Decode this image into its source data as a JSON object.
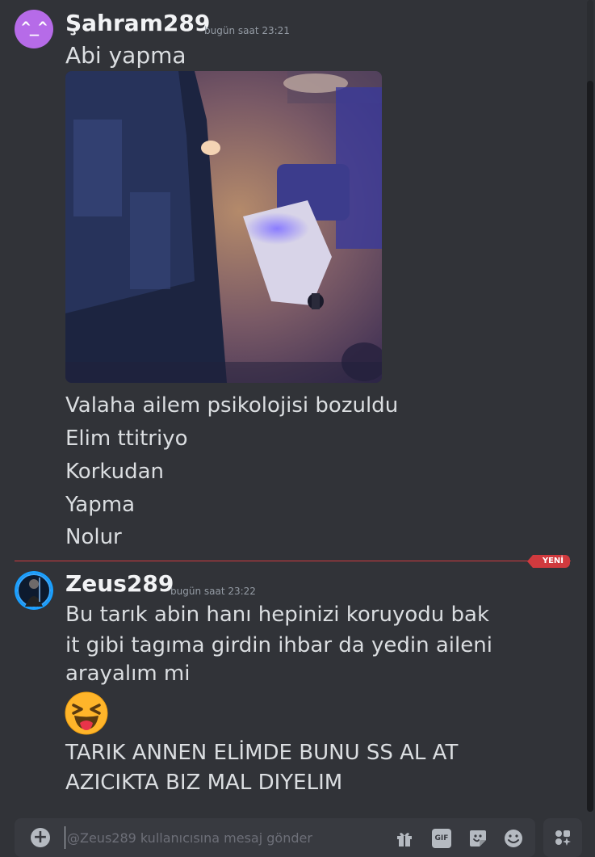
{
  "messages": [
    {
      "username": "Şahram289",
      "timestamp": "bugün saat 23:21",
      "lines": [
        "Abi yapma",
        "Valaha ailem psikolojisi bozuldu",
        "Elim ttitriyo",
        "Korkudan",
        "Yapma",
        "Nolur"
      ]
    },
    {
      "username": "Zeus289",
      "timestamp": "bugün saat 23:22",
      "lines": [
        "Bu tarık abin hanı hepinizi koruyodu bak",
        "it gibi tagıma  girdin ihbar da yedin aileni",
        "arayalım mi",
        "TARIK ANNEN ELİMDE BUNU SS AL AT",
        "AZICIKTA BIZ MAL DIYELIM"
      ],
      "emoji": "squinting-face-with-tongue"
    }
  ],
  "divider": {
    "label": "YENİ",
    "color": "#d03a3e"
  },
  "composer": {
    "placeholder": "@Zeus289 kullanıcısına mesaj gönder",
    "gif_label": "GIF",
    "icons": [
      "plus-icon",
      "gift-icon",
      "gif-icon",
      "sticker-icon",
      "emoji-icon",
      "apps-icon"
    ]
  },
  "colors": {
    "background": "#313338",
    "text": "#dbdee1",
    "username": "#f2f3f5",
    "timestamp": "#949ba4",
    "accent_new": "#d03a3e",
    "input": "#383a40"
  }
}
